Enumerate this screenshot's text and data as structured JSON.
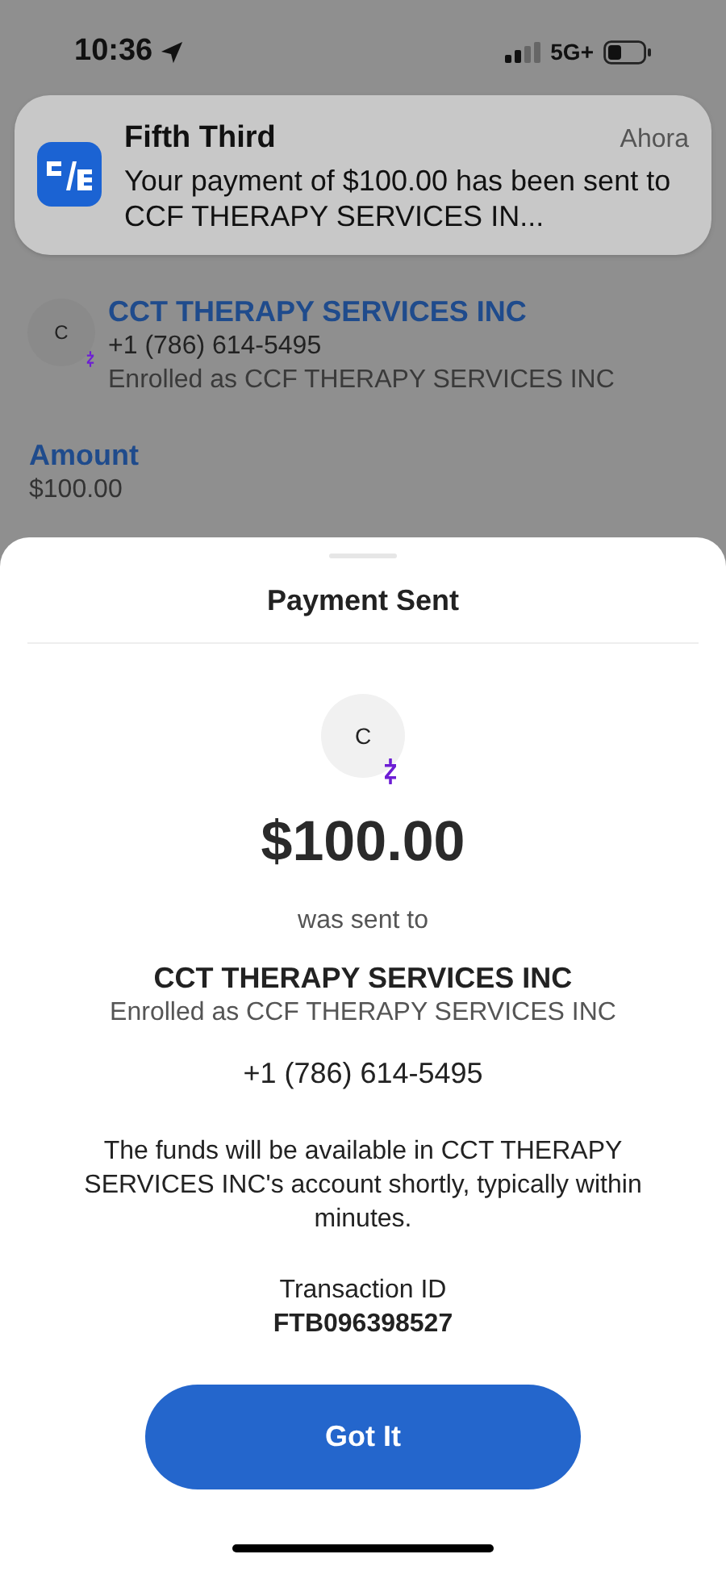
{
  "status_bar": {
    "time": "10:36",
    "network": "5G+"
  },
  "notification": {
    "app": "Fifth Third",
    "time": "Ahora",
    "message": "Your payment of $100.00 has been sent to CCF THERAPY SERVICES IN..."
  },
  "background": {
    "recipient": {
      "initial": "C",
      "name": "CCT THERAPY SERVICES INC",
      "phone": "+1 (786) 614-5495",
      "enrolled": "Enrolled as CCF THERAPY SERVICES INC"
    },
    "amount_label": "Amount",
    "amount": "$100.00"
  },
  "sheet": {
    "title": "Payment Sent",
    "initial": "C",
    "amount": "$100.00",
    "sent_to": "was sent to",
    "name": "CCT THERAPY SERVICES INC",
    "enrolled": "Enrolled as CCF THERAPY SERVICES INC",
    "phone": "+1 (786) 614-5495",
    "note": "The funds will be available in CCT THERAPY SERVICES INC's account shortly, typically within minutes.",
    "transaction_label": "Transaction ID",
    "transaction_id": "FTB096398527",
    "button": "Got It"
  }
}
